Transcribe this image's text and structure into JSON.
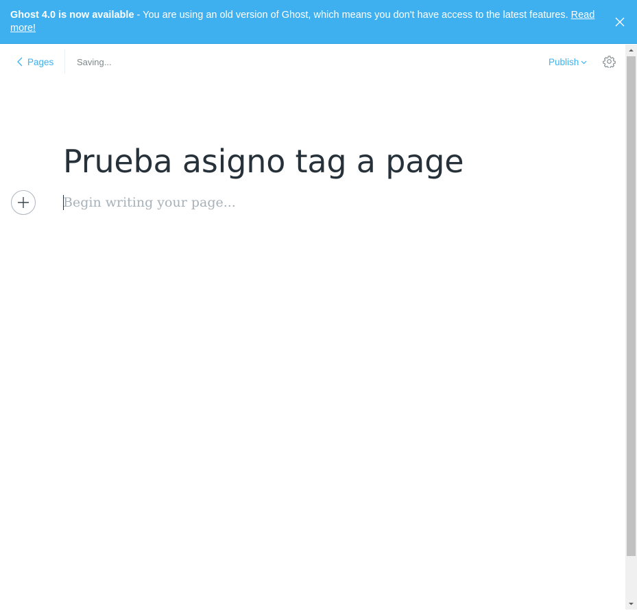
{
  "banner": {
    "bold_text": "Ghost 4.0 is now available",
    "message": " - You are using an old version of Ghost, which means you don't have access to the latest features. ",
    "link_text": "Read more!",
    "close_icon": "close-icon",
    "background_color": "#3eb0ef"
  },
  "toolbar": {
    "back_label": "Pages",
    "status_text": "Saving...",
    "publish_label": "Publish",
    "settings_icon": "gear-icon",
    "accent_color": "#3eb0ef"
  },
  "editor": {
    "title": "Prueba asigno tag a page",
    "body_placeholder": "Begin writing your page...",
    "add_card_icon": "plus-icon"
  }
}
